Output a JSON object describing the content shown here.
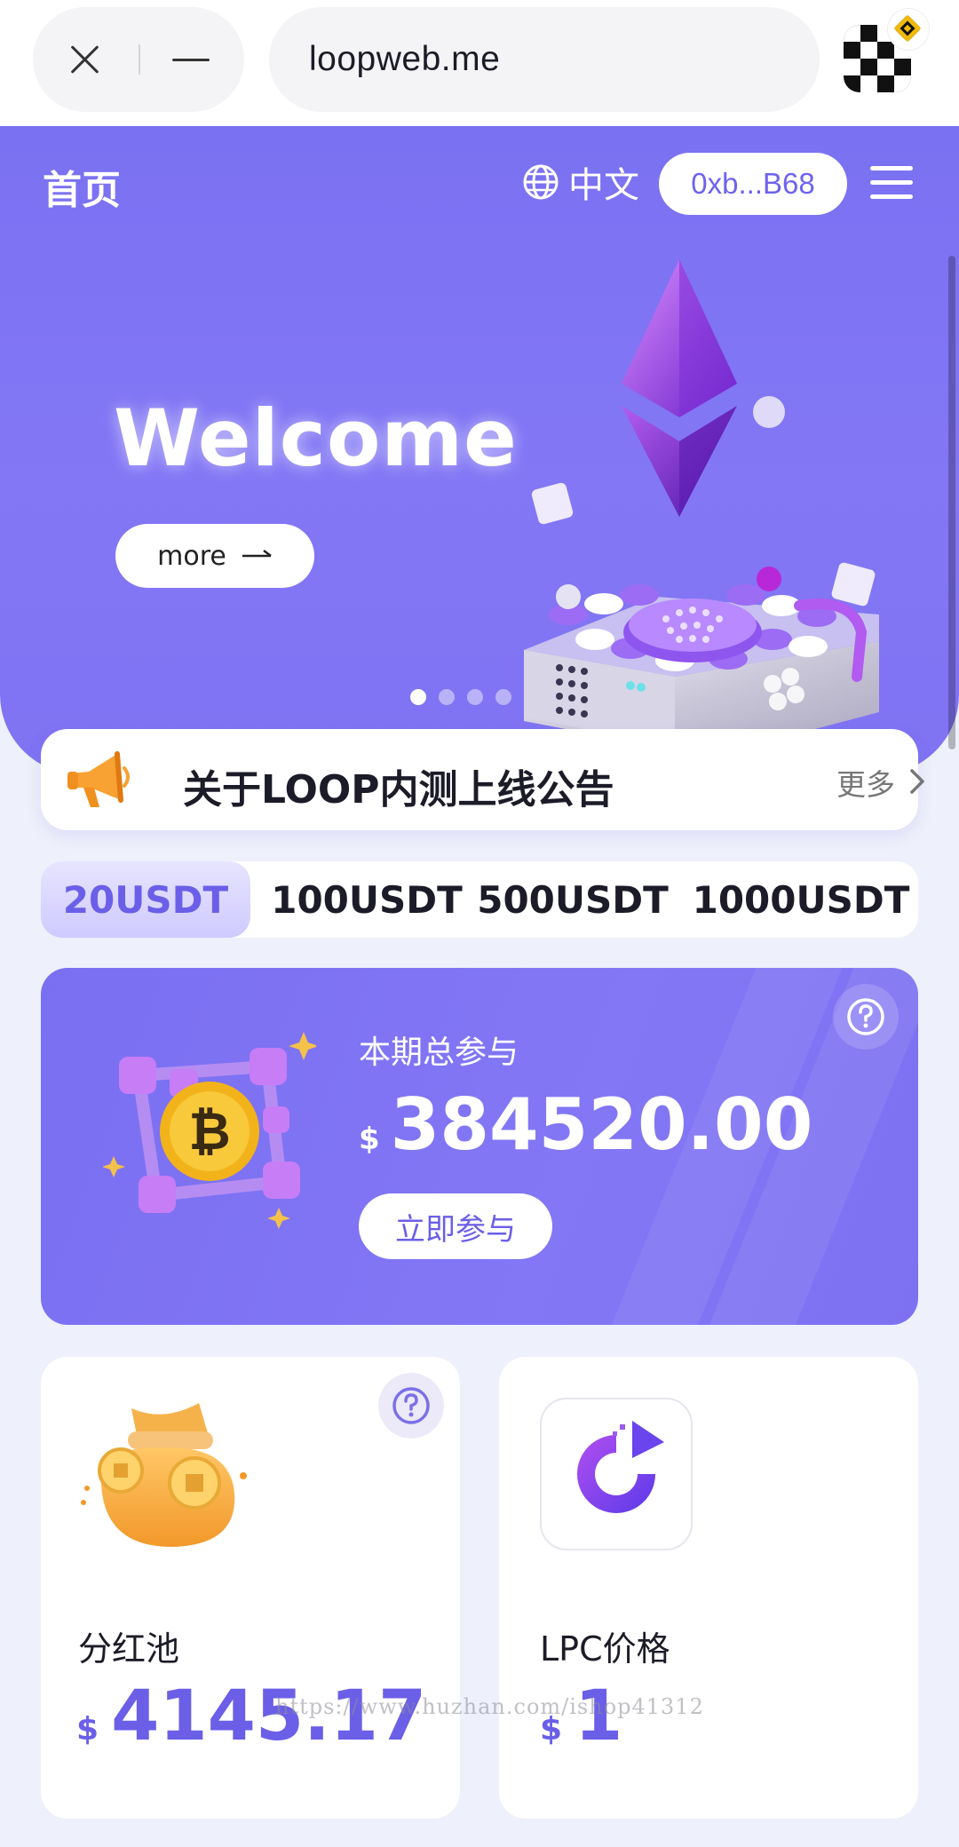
{
  "browser": {
    "url": "loopweb.me"
  },
  "header": {
    "title": "首页",
    "language": "中文",
    "wallet_address": "0xb...B68"
  },
  "banner": {
    "headline": "Welcome",
    "more_label": "more",
    "slide_count": 4,
    "active_slide": 1
  },
  "notice": {
    "text": "关于LOOP内测上线公告",
    "more_label": "更多"
  },
  "tabs": [
    {
      "label": "20USDT",
      "active": true
    },
    {
      "label": "100USDT",
      "active": false
    },
    {
      "label": "500USDT",
      "active": false
    },
    {
      "label": "1000USDT",
      "active": false
    }
  ],
  "participation": {
    "label": "本期总参与",
    "currency": "$",
    "amount": "384520.00",
    "button_label": "立即参与"
  },
  "dividend_pool": {
    "label": "分红池",
    "currency": "$",
    "value": "4145.17"
  },
  "lpc_price": {
    "label": "LPC价格",
    "currency": "$",
    "value": "1"
  },
  "watermark": "https://www.huzhan.com/ishop41312",
  "colors": {
    "brand": "#7a6ff1",
    "accent_text": "#6b5fe8",
    "background": "#eef0fb"
  }
}
